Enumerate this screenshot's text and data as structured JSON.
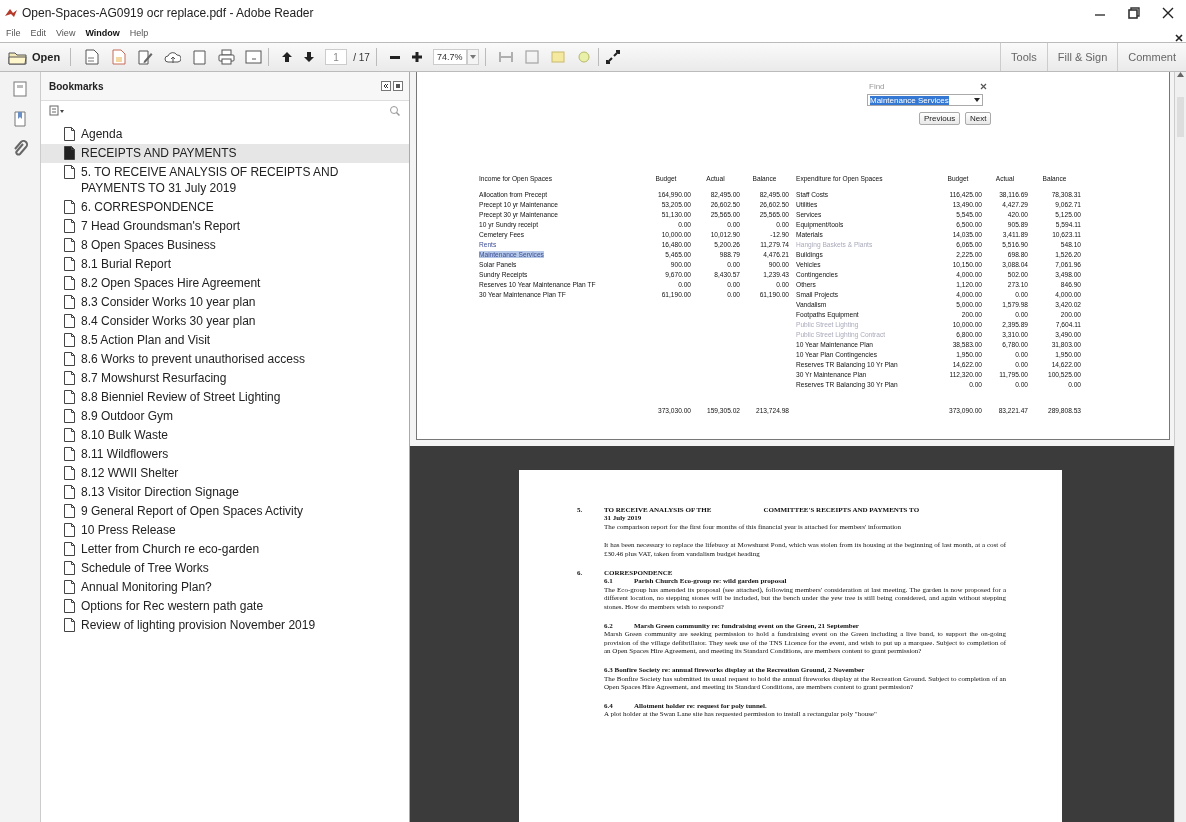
{
  "window": {
    "title": "Open-Spaces-AG0919 ocr replace.pdf - Adobe Reader"
  },
  "menu": [
    "File",
    "Edit",
    "View",
    "Window",
    "Help"
  ],
  "toolbar": {
    "open": "Open",
    "page": "1",
    "page_count": "/ 17",
    "zoom": "74.7%"
  },
  "task_buttons": [
    "Tools",
    "Fill & Sign",
    "Comment"
  ],
  "bookmarks": {
    "title": "Bookmarks",
    "items": [
      {
        "label": "Agenda",
        "selected": false
      },
      {
        "label": "RECEIPTS AND PAYMENTS",
        "selected": true
      },
      {
        "label": "5. TO RECEIVE ANALYSIS OF RECEIPTS AND PAYMENTS TO 31 July 2019",
        "selected": false
      },
      {
        "label": "6. CORRESPONDENCE",
        "selected": false
      },
      {
        "label": "7 Head Groundsman's Report",
        "selected": false
      },
      {
        "label": "8 Open Spaces Business",
        "selected": false
      },
      {
        "label": "8.1 Burial Report",
        "selected": false
      },
      {
        "label": "8.2 Open Spaces Hire Agreement",
        "selected": false
      },
      {
        "label": "8.3 Consider Works 10 year plan",
        "selected": false
      },
      {
        "label": "8.4 Consider Works 30 year plan",
        "selected": false
      },
      {
        "label": "8.5 Action Plan and Visit",
        "selected": false
      },
      {
        "label": "8.6 Works to prevent unauthorised access",
        "selected": false
      },
      {
        "label": "8.7 Mowshurst Resurfacing",
        "selected": false
      },
      {
        "label": "8.8 Bienniel Review of Street Lighting",
        "selected": false
      },
      {
        "label": "8.9 Outdoor Gym",
        "selected": false
      },
      {
        "label": "8.10 Bulk Waste",
        "selected": false
      },
      {
        "label": "8.11 Wildflowers",
        "selected": false
      },
      {
        "label": "8.12 WWII Shelter",
        "selected": false
      },
      {
        "label": "8.13 Visitor Direction Signage",
        "selected": false
      },
      {
        "label": "9 General Report of Open Spaces Activity",
        "selected": false
      },
      {
        "label": "10 Press Release",
        "selected": false
      },
      {
        "label": "Letter from Church re eco-garden",
        "selected": false
      },
      {
        "label": "Schedule of Tree Works",
        "selected": false
      },
      {
        "label": "Annual Monitoring Plan?",
        "selected": false
      },
      {
        "label": "Options for Rec western path gate",
        "selected": false
      },
      {
        "label": "Review of lighting provision November 2019",
        "selected": false
      }
    ]
  },
  "find": {
    "title": "Find",
    "value": "Maintenance Services",
    "buttons": [
      "Previous",
      "Next"
    ]
  },
  "income": {
    "heading": "Income for Open Spaces",
    "columns": [
      "Budget",
      "Actual",
      "Balance"
    ],
    "rows": [
      {
        "name": "Allocation from Precept",
        "budget": "164,990.00",
        "actual": "82,495.00",
        "balance": "82,495.00",
        "link": false,
        "highlighted": false
      },
      {
        "name": "Precept 10 yr Maintenance",
        "budget": "53,205.00",
        "actual": "26,602.50",
        "balance": "26,602.50",
        "link": false,
        "highlighted": false
      },
      {
        "name": "Precept 30 yr Maintenance",
        "budget": "51,130.00",
        "actual": "25,565.00",
        "balance": "25,565.00",
        "link": false,
        "highlighted": false
      },
      {
        "name": "10 yr Sundry receipt",
        "budget": "0.00",
        "actual": "0.00",
        "balance": "0.00",
        "link": false,
        "highlighted": false
      },
      {
        "name": "Cemetery Fees",
        "budget": "10,000.00",
        "actual": "10,012.90",
        "balance": "-12.90",
        "link": false,
        "highlighted": false
      },
      {
        "name": "Rents",
        "budget": "16,480.00",
        "actual": "5,200.26",
        "balance": "11,279.74",
        "link": true,
        "highlighted": false
      },
      {
        "name": "Maintenance Services",
        "budget": "5,465.00",
        "actual": "988.79",
        "balance": "4,476.21",
        "link": true,
        "highlighted": true
      },
      {
        "name": "Solar Panels",
        "budget": "900.00",
        "actual": "0.00",
        "balance": "900.00",
        "link": false,
        "highlighted": false
      },
      {
        "name": "Sundry Receipts",
        "budget": "9,670.00",
        "actual": "8,430.57",
        "balance": "1,239.43",
        "link": false,
        "highlighted": false
      },
      {
        "name": "Reserves 10 Year Maintenance Plan TF",
        "budget": "0.00",
        "actual": "0.00",
        "balance": "0.00",
        "link": false,
        "highlighted": false
      },
      {
        "name": "30 Year Maintenance Plan TF",
        "budget": "61,190.00",
        "actual": "0.00",
        "balance": "61,190.00",
        "link": false,
        "highlighted": false
      }
    ],
    "totals": [
      "373,030.00",
      "159,305.02",
      "213,724.98"
    ]
  },
  "expenditure": {
    "heading": "Expenditure for Open Spaces",
    "columns": [
      "Budget",
      "Actual",
      "Balance"
    ],
    "rows": [
      {
        "name": "Staff Costs",
        "budget": "116,425.00",
        "actual": "38,116.69",
        "balance": "78,308.31",
        "faded": false
      },
      {
        "name": "Utilities",
        "budget": "13,490.00",
        "actual": "4,427.29",
        "balance": "9,062.71",
        "faded": false
      },
      {
        "name": "Services",
        "budget": "5,545.00",
        "actual": "420.00",
        "balance": "5,125.00",
        "faded": false
      },
      {
        "name": "Equipment/tools",
        "budget": "6,500.00",
        "actual": "905.89",
        "balance": "5,594.11",
        "faded": false
      },
      {
        "name": "Materials",
        "budget": "14,035.00",
        "actual": "3,411.89",
        "balance": "10,623.11",
        "faded": false
      },
      {
        "name": "Hanging Baskets & Plants",
        "budget": "6,065.00",
        "actual": "5,516.90",
        "balance": "548.10",
        "faded": true
      },
      {
        "name": "Buildings",
        "budget": "2,225.00",
        "actual": "698.80",
        "balance": "1,526.20",
        "faded": false
      },
      {
        "name": "Vehicles",
        "budget": "10,150.00",
        "actual": "3,088.04",
        "balance": "7,061.96",
        "faded": false
      },
      {
        "name": "Contingencies",
        "budget": "4,000.00",
        "actual": "502.00",
        "balance": "3,498.00",
        "faded": false
      },
      {
        "name": "Others",
        "budget": "1,120.00",
        "actual": "273.10",
        "balance": "846.90",
        "faded": false
      },
      {
        "name": "Small Projects",
        "budget": "4,000.00",
        "actual": "0.00",
        "balance": "4,000.00",
        "faded": false
      },
      {
        "name": "Vandalism",
        "budget": "5,000.00",
        "actual": "1,579.98",
        "balance": "3,420.02",
        "faded": false
      },
      {
        "name": "Footpaths Equipment",
        "budget": "200.00",
        "actual": "0.00",
        "balance": "200.00",
        "faded": false
      },
      {
        "name": "Public Street Lighting",
        "budget": "10,000.00",
        "actual": "2,395.89",
        "balance": "7,604.11",
        "faded": true
      },
      {
        "name": "Public Street Lighting Contract",
        "budget": "6,800.00",
        "actual": "3,310.00",
        "balance": "3,490.00",
        "faded": true
      },
      {
        "name": "10 Year Maintenance Plan",
        "budget": "38,583.00",
        "actual": "6,780.00",
        "balance": "31,803.00",
        "faded": false
      },
      {
        "name": "10 Year Plan Contingencies",
        "budget": "1,950.00",
        "actual": "0.00",
        "balance": "1,950.00",
        "faded": false
      },
      {
        "name": "Reserves TR Balancing 10 Yr Plan",
        "budget": "14,622.00",
        "actual": "0.00",
        "balance": "14,622.00",
        "faded": false
      },
      {
        "name": "30 Yr Maintenance Plan",
        "budget": "112,320.00",
        "actual": "11,795.00",
        "balance": "100,525.00",
        "faded": false
      },
      {
        "name": "Reserves TR Balancing 30 Yr Plan",
        "budget": "0.00",
        "actual": "0.00",
        "balance": "0.00",
        "faded": false
      }
    ],
    "totals": [
      "373,090.00",
      "83,221.47",
      "289,808.53"
    ]
  },
  "document": [
    {
      "kind": "section",
      "number": "5.",
      "parts": [
        "TO RECEIVE ANALYSIS OF THE",
        "COMMITTEE'S RECEIPTS AND PAYMENTS TO"
      ]
    },
    {
      "kind": "subtitle",
      "text": "31 July 2019"
    },
    {
      "kind": "para",
      "text": "The comparison report for the first four months of this financial year is attached for members' information"
    },
    {
      "kind": "para",
      "text": "It has been necessary to replace the lifebuoy at Mowshurst Pond, which was stolen from its housing at the beginning of last month, at a cost of £30.46 plus VAT, taken from vandalism budget heading"
    },
    {
      "kind": "section",
      "number": "6.",
      "parts": [
        "CORRESPONDENCE"
      ]
    },
    {
      "kind": "sub",
      "number": "6.1",
      "text": "Parish Church Eco-group re: wild garden proposal"
    },
    {
      "kind": "para",
      "text": "The Eco-group has amended its proposal (see attached), following members' consideration at last meeting. The garden is now proposed for a different location, no stepping stones will be included, but the bench under the yew tree is still being considered, and again without stepping stones. How do members wish to respond?"
    },
    {
      "kind": "sub",
      "number": "6.2",
      "text": "Marsh Green community re: fundraising event on the Green, 21 September"
    },
    {
      "kind": "para",
      "text": "Marsh Green community are seeking permission to hold a fundraising event on the Green including a live band, to support the on-going provision of the village defibrillator. They seek use of the TNS Licence for the event, and wish to put up a marquee. Subject to completion of an Open Spaces Hire Agreement, and meeting its Standard Conditions, are members content to grant permission?"
    },
    {
      "kind": "subline",
      "text": "6.3 Bonfire Society re: annual fireworks display at the Recreation Ground, 2 November"
    },
    {
      "kind": "para",
      "text": "The Bonfire Society has submitted its usual request to hold the annual fireworks display at the Recreation Ground. Subject to completion of an Open Spaces Hire Agreement, and meeting its Standard Conditions, are members content to grant permission?"
    },
    {
      "kind": "sub",
      "number": "6.4",
      "text": "Allotment holder re: request for poly tunnel."
    },
    {
      "kind": "para",
      "text": "A plot holder at the Swan Lane site has requested permission to install a rectangular poly \"house\""
    }
  ]
}
